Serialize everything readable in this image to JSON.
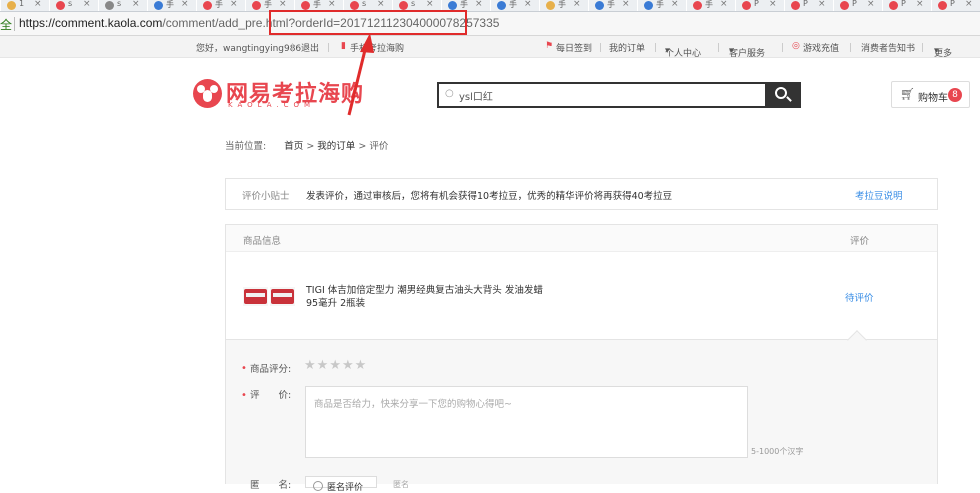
{
  "browser": {
    "tabs": [
      {
        "text": "1",
        "color": "#e7b04b"
      },
      {
        "text": "s",
        "color": "#e8464f"
      },
      {
        "text": "s",
        "color": "#888888"
      },
      {
        "text": "手",
        "color": "#3a7bd5"
      },
      {
        "text": "手",
        "color": "#e8464f"
      },
      {
        "text": "手",
        "color": "#e8464f"
      },
      {
        "text": "手",
        "color": "#e8464f"
      },
      {
        "text": "s",
        "color": "#e8464f"
      },
      {
        "text": "s",
        "color": "#e8464f"
      },
      {
        "text": "手",
        "color": "#3a7bd5"
      },
      {
        "text": "手",
        "color": "#3a7bd5"
      },
      {
        "text": "手",
        "color": "#e7b04b"
      },
      {
        "text": "手",
        "color": "#3a7bd5"
      },
      {
        "text": "手",
        "color": "#3a7bd5"
      },
      {
        "text": "手",
        "color": "#e8464f"
      },
      {
        "text": "P",
        "color": "#e8464f"
      },
      {
        "text": "P",
        "color": "#e8464f"
      },
      {
        "text": "P",
        "color": "#e8464f"
      },
      {
        "text": "P",
        "color": "#e8464f"
      },
      {
        "text": "P",
        "color": "#e8464f"
      }
    ],
    "security_label": "全",
    "url_main": "https://comment.kaola.com",
    "url_path": "/comment/add_pre.html",
    "url_query": "?orderId=20171211230400007825733​5"
  },
  "topnav": {
    "greeting": "您好，wangtingying986",
    "logout": "退出",
    "mobile": "手机考拉海购",
    "checkin": "每日签到",
    "orders": "我的订单",
    "personal": "个人中心",
    "service": "客户服务",
    "game": "游戏充值",
    "notice": "消费者告知书",
    "more": "更多"
  },
  "header": {
    "logo_text": "网易考拉海购",
    "logo_sub": "KAOLA.COM",
    "search_value": "ysl口红",
    "cart_label": "购物车",
    "cart_count": "8"
  },
  "breadcrumb": {
    "prefix": "当前位置:",
    "home": "首页",
    "orders": "我的订单",
    "current": "评价"
  },
  "tip": {
    "label": "评价小贴士",
    "text": "发表评价，通过审核后，您将有机会获得10考拉豆，优秀的精华评价将再获得40考拉豆",
    "link": "考拉豆说明"
  },
  "product_table": {
    "col_product": "商品信息",
    "col_review": "评价",
    "product_name": "TIGI 体吉加倍定型力 潮男经典复古油头大背头 发油发蜡 95毫升 2瓶装",
    "status": "待评价"
  },
  "form": {
    "rating_label": "商品评分:",
    "review_label": "评　　价:",
    "review_placeholder": "商品是否给力，快来分享一下您的购物心得吧~",
    "char_limit": "5-1000个汉字",
    "anon_label": "匿　　名:",
    "anon_option": "匿名评价",
    "anon_hint": "匿名"
  }
}
